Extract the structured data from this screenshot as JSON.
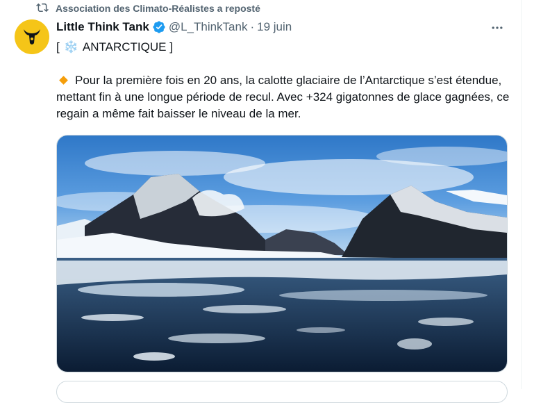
{
  "repost": {
    "icon": "repost-icon",
    "text": "Association des Climato-Réalistes a reposté"
  },
  "tweet": {
    "author": {
      "name": "Little Think Tank",
      "handle": "@L_ThinkTank",
      "verified": true,
      "avatar_color": "#f5c518"
    },
    "separator": "·",
    "date": "19 juin",
    "tag_open": "[",
    "tag_emoji": "❄️",
    "tag_text": "ANTARCTIQUE ]",
    "bullet_icon": "orange-diamond-icon",
    "body": "Pour la première fois en 20 ans, la calotte glaciaire de l’Antarctique s’est étendue, mettant fin à une longue période de recul. Avec +324 gigatonnes de glace gagnées, ce regain a même fait baisser le niveau de la mer.",
    "media": {
      "type": "photo",
      "subject": "antarctic-mountains-sea-ice-photo"
    }
  },
  "colors": {
    "text": "#0f1419",
    "secondary": "#536471",
    "verified": "#1d9bf0",
    "border": "#cfd9de",
    "bullet": "#f59e0b"
  }
}
